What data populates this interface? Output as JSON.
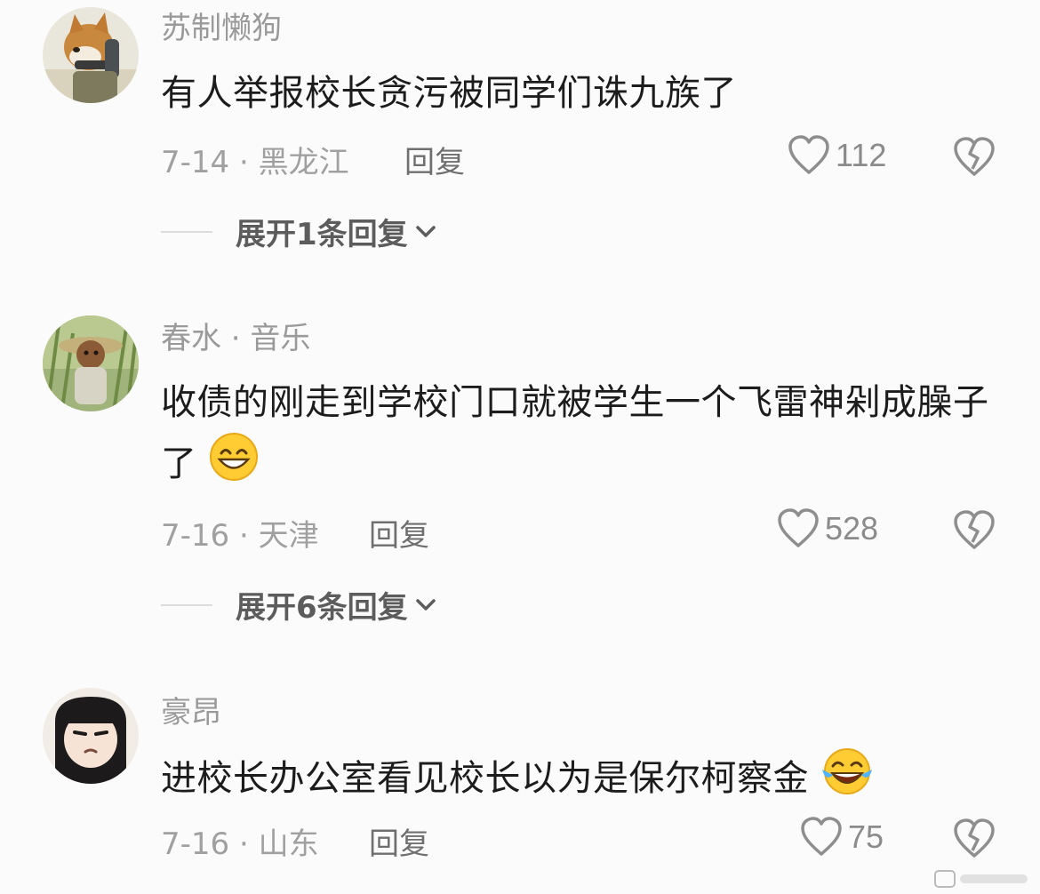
{
  "comments": [
    {
      "username": "苏制懒狗",
      "text": "有人举报校长贪污被同学们诛九族了",
      "date_location": "7-14 · 黑龙江",
      "reply_label": "回复",
      "likes": "112",
      "expand_label": "展开1条回复"
    },
    {
      "username": "春水 · 音乐",
      "text": "收债的刚走到学校门口就被学生一个飞雷神剁成臊子了",
      "date_location": "7-16 · 天津",
      "reply_label": "回复",
      "likes": "528",
      "expand_label": "展开6条回复"
    },
    {
      "username": "豪昂",
      "text": "进校长办公室看见校长以为是保尔柯察金",
      "date_location": "7-16 · 山东",
      "reply_label": "回复",
      "likes": "75"
    }
  ],
  "icons": {
    "like": "heart-outline-icon",
    "dislike": "broken-heart-icon",
    "expand": "chevron-down-icon",
    "emoji_grin": "grinning-face-icon",
    "emoji_laugh": "tears-of-joy-icon"
  },
  "colors": {
    "text": "#1c1c1c",
    "meta": "#a0a0a0",
    "icon": "#8e8e8e"
  }
}
